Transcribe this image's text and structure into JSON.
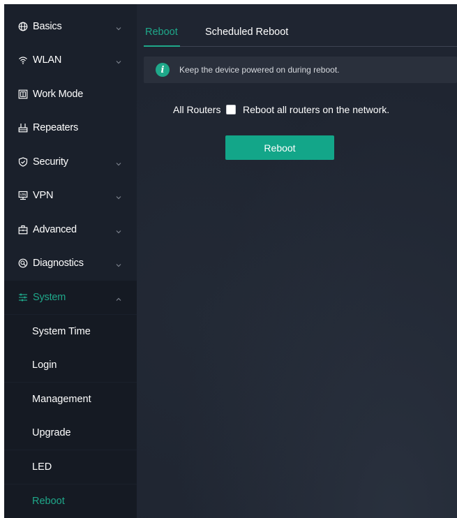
{
  "sidebar": {
    "items": [
      {
        "label": "Basics",
        "icon": "globe-icon",
        "expandable": true
      },
      {
        "label": "WLAN",
        "icon": "wifi-icon",
        "expandable": true
      },
      {
        "label": "Work Mode",
        "icon": "work-mode-icon",
        "expandable": false
      },
      {
        "label": "Repeaters",
        "icon": "repeater-icon",
        "expandable": false
      },
      {
        "label": "Security",
        "icon": "shield-check-icon",
        "expandable": true
      },
      {
        "label": "VPN",
        "icon": "vpn-icon",
        "expandable": true
      },
      {
        "label": "Advanced",
        "icon": "advanced-icon",
        "expandable": true
      },
      {
        "label": "Diagnostics",
        "icon": "diagnostics-icon",
        "expandable": true
      },
      {
        "label": "System",
        "icon": "sliders-icon",
        "expandable": true,
        "expanded": true,
        "active": true
      }
    ],
    "system_sub_items": [
      {
        "label": "System Time"
      },
      {
        "label": "Login"
      },
      {
        "label": "Management"
      },
      {
        "label": "Upgrade"
      },
      {
        "label": "LED"
      },
      {
        "label": "Reboot",
        "active": true
      }
    ]
  },
  "tabs": [
    {
      "label": "Reboot",
      "active": true
    },
    {
      "label": "Scheduled Reboot",
      "active": false
    }
  ],
  "info": {
    "icon": "info-icon",
    "text": "Keep the device powered on during reboot."
  },
  "form": {
    "row_label": "All Routers",
    "checkbox_label": "Reboot all routers on the network.",
    "checkbox_checked": false,
    "button_label": "Reboot"
  },
  "colors": {
    "accent": "#1fa88a",
    "sidebar_bg": "#1a202b",
    "main_bg": "#1f2531"
  }
}
